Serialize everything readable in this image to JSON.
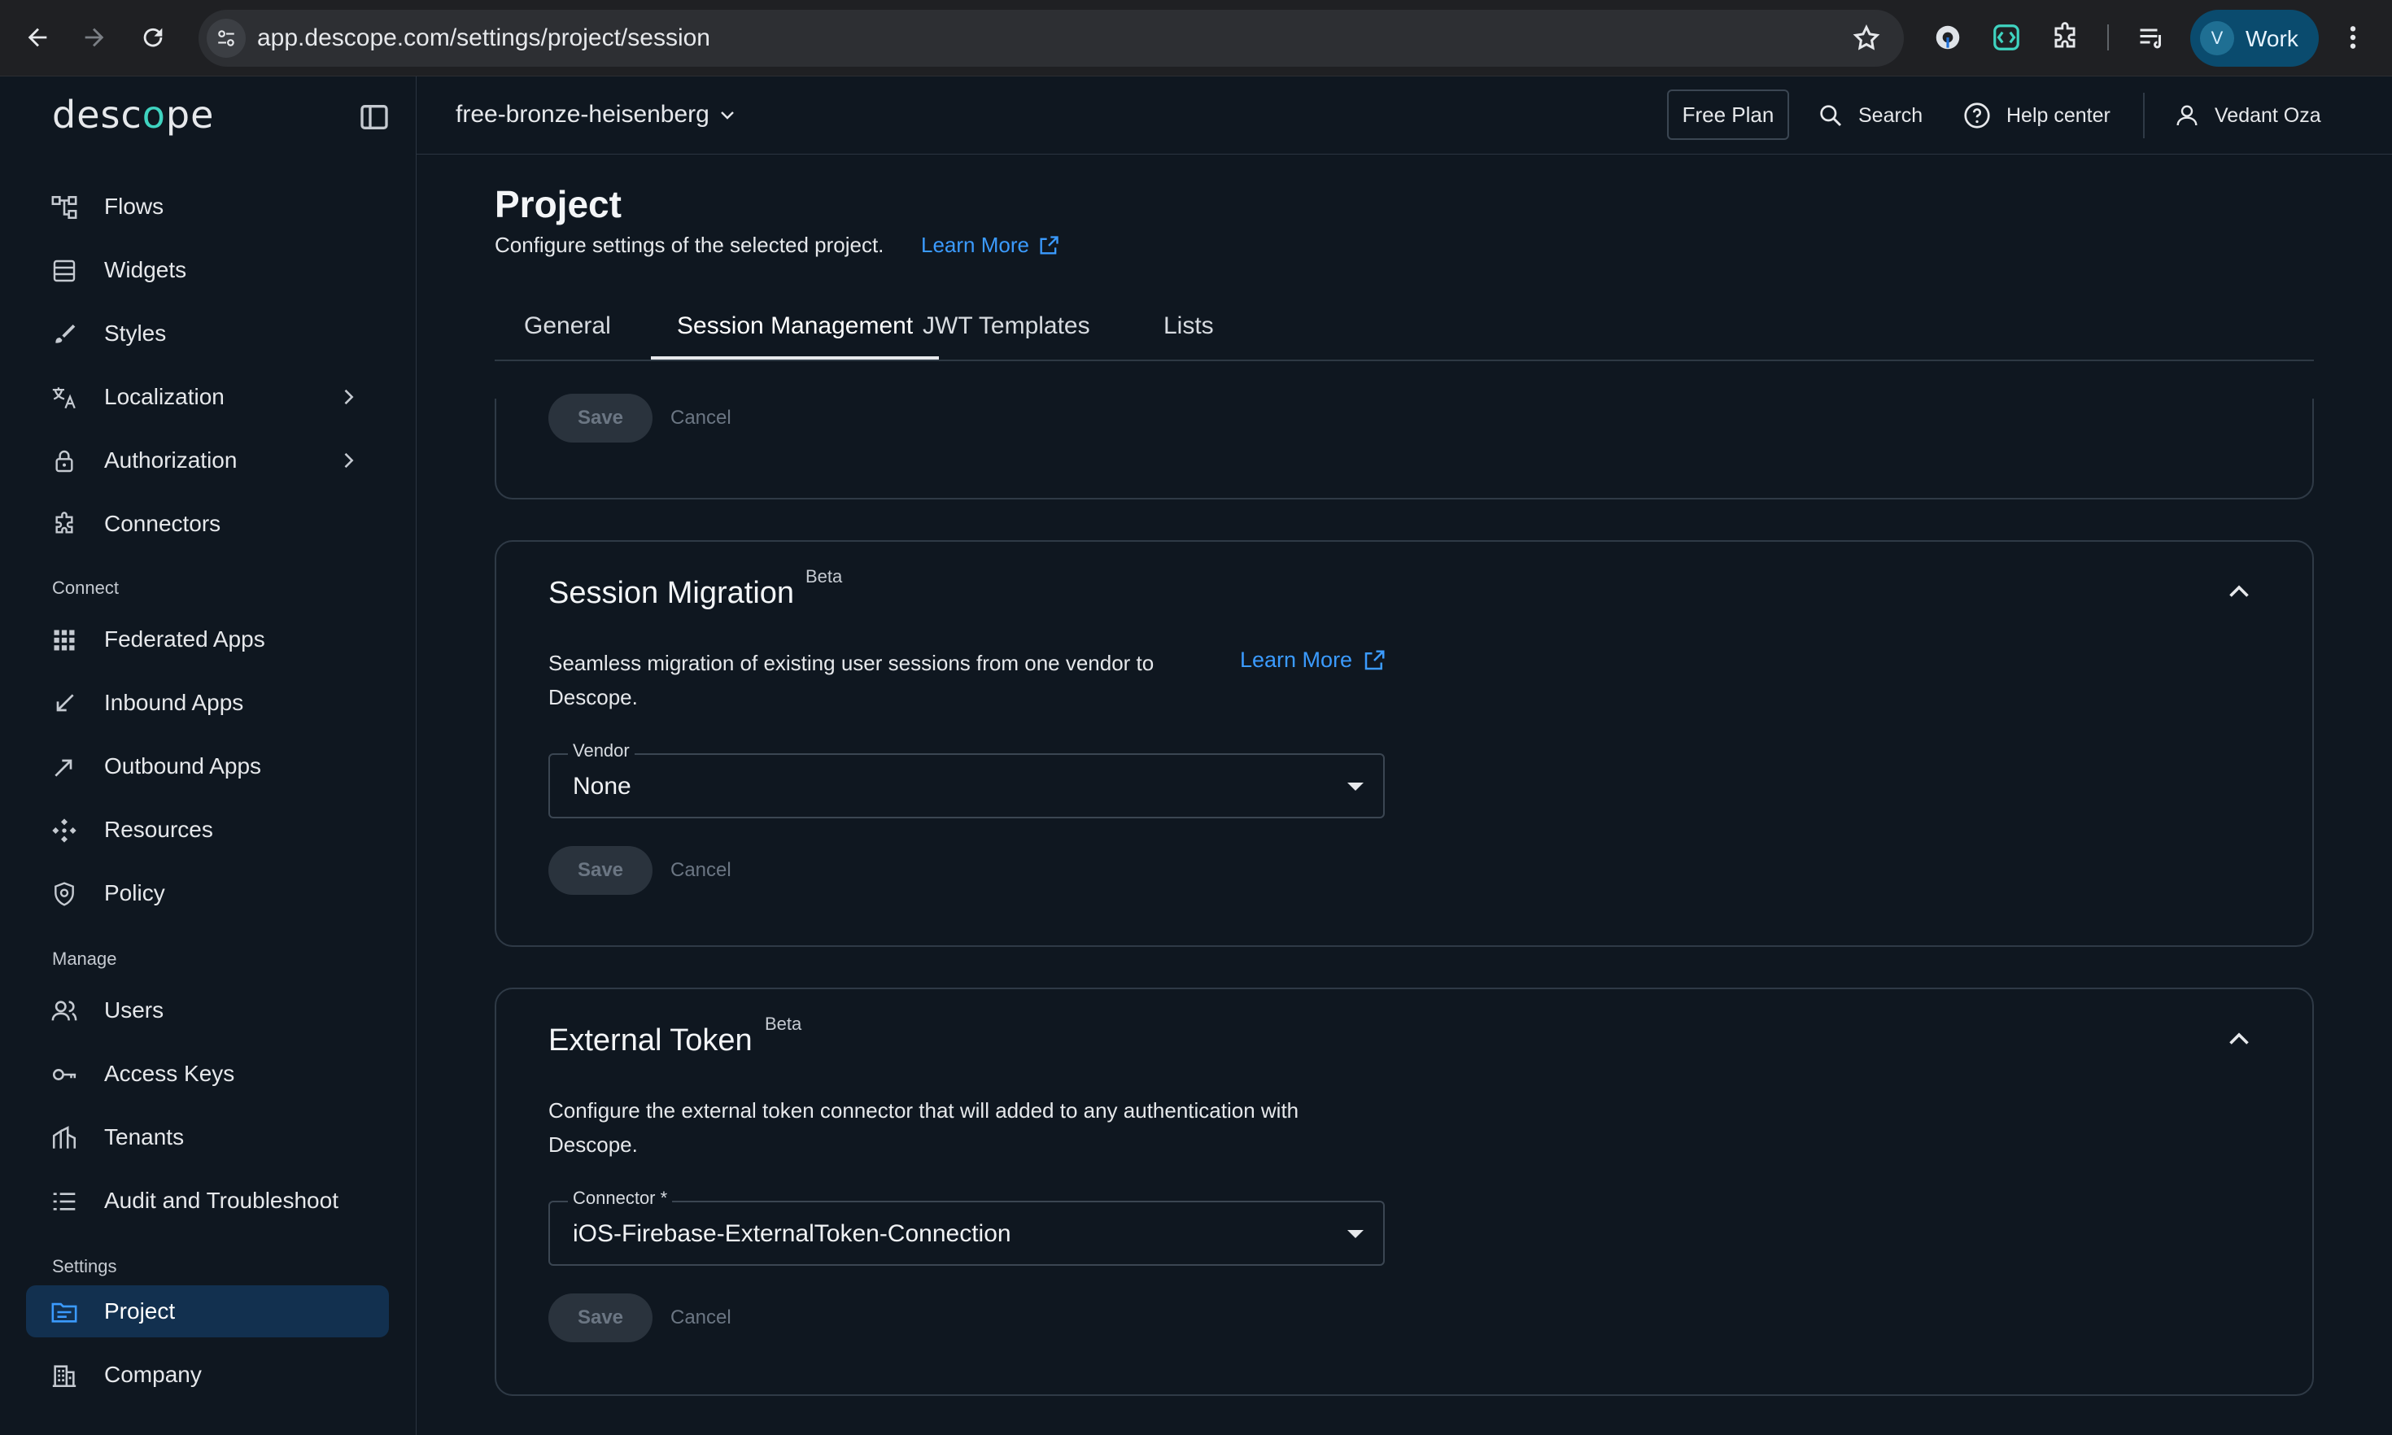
{
  "browser": {
    "url": "app.descope.com/settings/project/session",
    "profile_initial": "V",
    "profile_label": "Work"
  },
  "sidebar": {
    "logo": {
      "before": "desc",
      "mark": "o",
      "after": "pe"
    },
    "items": [
      {
        "label": "Flows",
        "icon": "flows-icon"
      },
      {
        "label": "Widgets",
        "icon": "widgets-icon"
      },
      {
        "label": "Styles",
        "icon": "brush-icon"
      },
      {
        "label": "Localization",
        "icon": "translate-icon",
        "expandable": true
      },
      {
        "label": "Authorization",
        "icon": "lock-icon",
        "expandable": true
      },
      {
        "label": "Connectors",
        "icon": "puzzle-icon"
      }
    ],
    "connect_label": "Connect",
    "connect_items": [
      {
        "label": "Federated Apps",
        "icon": "grid-icon"
      },
      {
        "label": "Inbound Apps",
        "icon": "arrow-in-icon"
      },
      {
        "label": "Outbound Apps",
        "icon": "arrow-out-icon"
      },
      {
        "label": "Resources",
        "icon": "resources-icon"
      },
      {
        "label": "Policy",
        "icon": "shield-icon"
      }
    ],
    "manage_label": "Manage",
    "manage_items": [
      {
        "label": "Users",
        "icon": "users-icon"
      },
      {
        "label": "Access Keys",
        "icon": "key-icon"
      },
      {
        "label": "Tenants",
        "icon": "tenants-icon"
      },
      {
        "label": "Audit and Troubleshoot",
        "icon": "list-icon"
      }
    ],
    "settings_label": "Settings",
    "settings_items": [
      {
        "label": "Project",
        "icon": "folder-icon",
        "active": true
      },
      {
        "label": "Company",
        "icon": "building-icon"
      }
    ]
  },
  "topbar": {
    "project_name": "free-bronze-heisenberg",
    "free_plan": "Free Plan",
    "search": "Search",
    "help": "Help center",
    "user": "Vedant Oza"
  },
  "page": {
    "title": "Project",
    "subtitle": "Configure settings of the selected project.",
    "learn_more": "Learn More",
    "tabs": [
      "General",
      "Session Management",
      "JWT Templates",
      "Lists"
    ],
    "active_tab": "Session Management"
  },
  "cards": {
    "top": {
      "save": "Save",
      "cancel": "Cancel"
    },
    "migration": {
      "title": "Session Migration",
      "badge": "Beta",
      "desc_line1": "Seamless migration of existing user sessions from one vendor to",
      "desc_line2": "Descope.",
      "learn_more": "Learn More",
      "field_label": "Vendor",
      "field_value": "None",
      "save": "Save",
      "cancel": "Cancel"
    },
    "external": {
      "title": "External Token",
      "badge": "Beta",
      "desc_line1": "Configure the external token connector that will added to any authentication with",
      "desc_line2": "Descope.",
      "field_label": "Connector *",
      "field_value": "iOS-Firebase-ExternalToken-Connection",
      "save": "Save",
      "cancel": "Cancel"
    }
  },
  "colors": {
    "accent_link": "#3b9bff",
    "active_nav": "#12304f",
    "background": "#0f1720"
  }
}
